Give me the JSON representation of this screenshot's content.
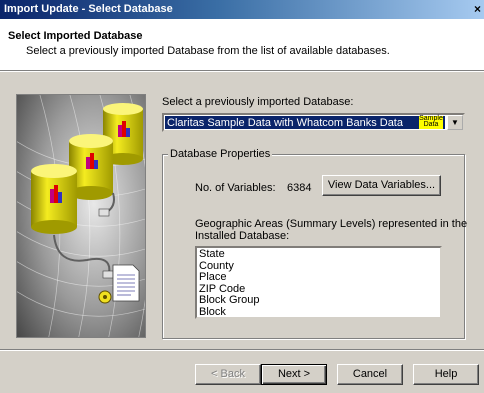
{
  "window": {
    "title": "Import Update - Select Database",
    "close_glyph": "×"
  },
  "header": {
    "title": "Select Imported Database",
    "subtitle": "Select a previously imported Database from the list of available databases."
  },
  "database_select": {
    "label": "Select a previously imported  Database:",
    "selected": "Claritas Sample Data with Whatcom Banks Data",
    "badge_line1": "Sample",
    "badge_line2": "Data",
    "arrow_glyph": "▼"
  },
  "properties": {
    "group_title": "Database Properties",
    "variables_label": "No. of Variables:",
    "variables_value": "6384",
    "view_button": "View Data Variables...",
    "geo_label_line1": "Geographic Areas (Summary Levels) represented in the",
    "geo_label_line2": "Installed Database:",
    "geo_areas": [
      "State",
      "County",
      "Place",
      "ZIP Code",
      "Block Group",
      "Block"
    ]
  },
  "buttons": {
    "back": "< Back",
    "next": "Next >",
    "cancel": "Cancel",
    "help": "Help"
  },
  "illustration": {
    "icons": [
      "database-cylinder-icon",
      "plug-cable-icon",
      "document-icon",
      "gear-icon"
    ],
    "colors": {
      "cylinder": "#e8e000",
      "background": "#7a7a7a"
    }
  }
}
